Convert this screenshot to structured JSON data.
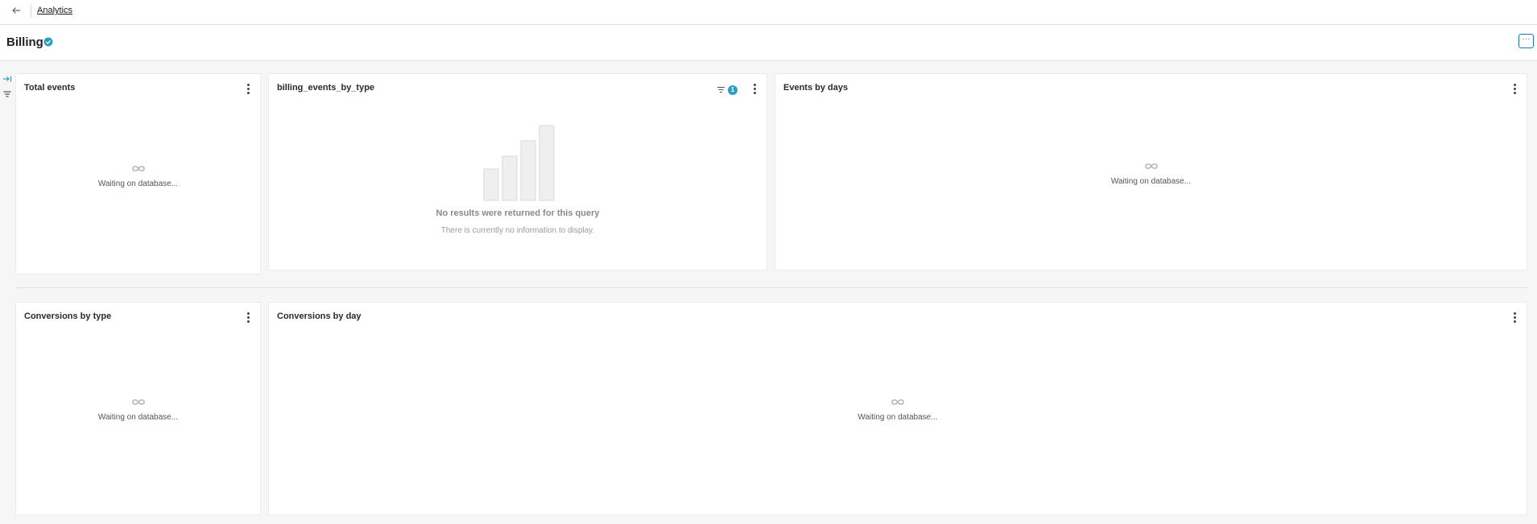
{
  "nav": {
    "breadcrumb": "Analytics"
  },
  "header": {
    "title": "Billing",
    "more_label": "···"
  },
  "colors": {
    "accent": "#1b7a9a",
    "badge": "#2b9ec4"
  },
  "cards": {
    "total_events": {
      "title": "Total events",
      "status": "Waiting on database..."
    },
    "billing_events_by_type": {
      "title": "billing_events_by_type",
      "filter_count": "1",
      "empty_title": "No results were returned for this query",
      "empty_subtitle": "There is currently no information to display."
    },
    "events_by_days": {
      "title": "Events by days",
      "status": "Waiting on database..."
    },
    "conversions_by_type": {
      "title": "Conversions by type",
      "status": "Waiting on database..."
    },
    "conversions_by_day": {
      "title": "Conversions by day",
      "status": "Waiting on database..."
    }
  },
  "icons": [
    "back-arrow-icon",
    "verified-icon",
    "collapse-sidebar-icon",
    "filter-icon",
    "kebab-menu-icon",
    "loading-loop-icon",
    "empty-bar-chart-icon"
  ]
}
